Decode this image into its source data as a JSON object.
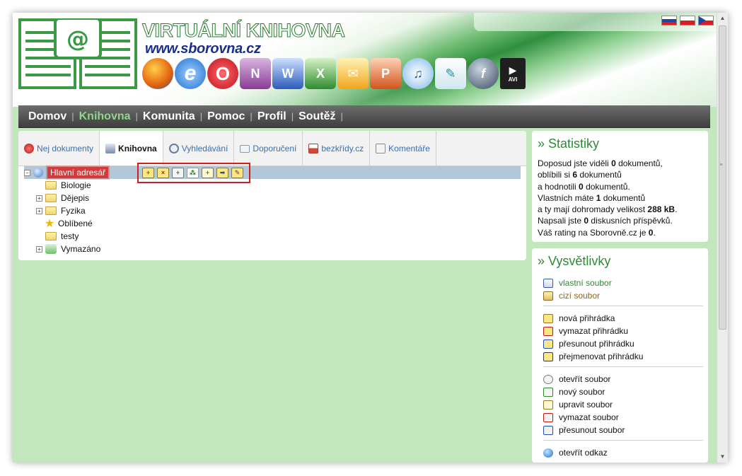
{
  "header": {
    "title": "VIRTUÁLNÍ KNIHOVNA",
    "url": "www.sborovna.cz",
    "app_icons": [
      "firefox-icon",
      "internet-explorer-icon",
      "opera-icon",
      "onenote-icon",
      "word-icon",
      "excel-icon",
      "outlook-icon",
      "powerpoint-icon",
      "music-icon",
      "quill-icon",
      "flash-icon",
      "avi-icon"
    ],
    "flags": [
      "slovak-flag-icon",
      "polish-flag-icon",
      "czech-flag-icon"
    ],
    "avi_label": "AVI"
  },
  "nav": {
    "items": [
      "Domov",
      "Knihovna",
      "Komunita",
      "Pomoc",
      "Profil",
      "Soutěž"
    ],
    "active": "Knihovna"
  },
  "tabs": [
    {
      "label": "Nej dokumenty",
      "icon": "award-icon"
    },
    {
      "label": "Knihovna",
      "icon": "library-icon"
    },
    {
      "label": "Vyhledávání",
      "icon": "search-icon"
    },
    {
      "label": "Doporučení",
      "icon": "mail-icon"
    },
    {
      "label": "bezkřídy.cz",
      "icon": "home-icon"
    },
    {
      "label": "Komentáře",
      "icon": "comments-icon"
    }
  ],
  "tree": {
    "root": "Hlavní adresář",
    "items": [
      {
        "label": "Biologie",
        "icon": "folder-icon",
        "expandable": false
      },
      {
        "label": "Dějepis",
        "icon": "folder-icon",
        "expandable": true
      },
      {
        "label": "Fyzika",
        "icon": "folder-icon",
        "expandable": true
      },
      {
        "label": "Oblíbené",
        "icon": "star-icon",
        "expandable": false
      },
      {
        "label": "testy",
        "icon": "folder-icon",
        "expandable": false
      },
      {
        "label": "Vymazáno",
        "icon": "recycle-bin-icon",
        "expandable": true
      }
    ],
    "toolbar_icons": [
      "new-folder-icon",
      "delete-folder-icon",
      "new-file-icon",
      "tree-icon",
      "add-document-icon",
      "move-icon",
      "rename-icon"
    ]
  },
  "stats": {
    "title": "» Statistiky",
    "line1_a": "Doposud jste viděli ",
    "line1_b": "0",
    "line1_c": " dokumentů,",
    "line2_a": "oblíbili si ",
    "line2_b": "6",
    "line2_c": " dokumentů",
    "line3_a": "a hodnotili ",
    "line3_b": "0",
    "line3_c": " dokumentů.",
    "line4_a": "Vlastních máte ",
    "line4_b": "1",
    "line4_c": " dokumentů",
    "line5_a": "a ty mají dohromady velikost ",
    "line5_b": "288 kB",
    "line5_c": ".",
    "line6_a": "Napsali jste ",
    "line6_b": "0",
    "line6_c": " diskusních příspěvků.",
    "line7_a": "Váš rating na Sborovně.cz je ",
    "line7_b": "0",
    "line7_c": "."
  },
  "legend": {
    "title": "» Vysvětlivky",
    "group1": [
      "vlastní soubor",
      "cizí soubor"
    ],
    "group2": [
      "nová přihrádka",
      "vymazat přihrádku",
      "přesunout přihrádku",
      "přejmenovat přihrádku"
    ],
    "group3": [
      "otevřít soubor",
      "nový soubor",
      "upravit soubor",
      "vymazat soubor",
      "přesunout soubor"
    ],
    "group4": [
      "otevřít odkaz"
    ]
  },
  "colors": {
    "page_bg": "#c3e7bd",
    "accent_green": "#2d8a35",
    "nav_bg": "#4e4e4e",
    "highlight_red": "#d21e1e"
  }
}
